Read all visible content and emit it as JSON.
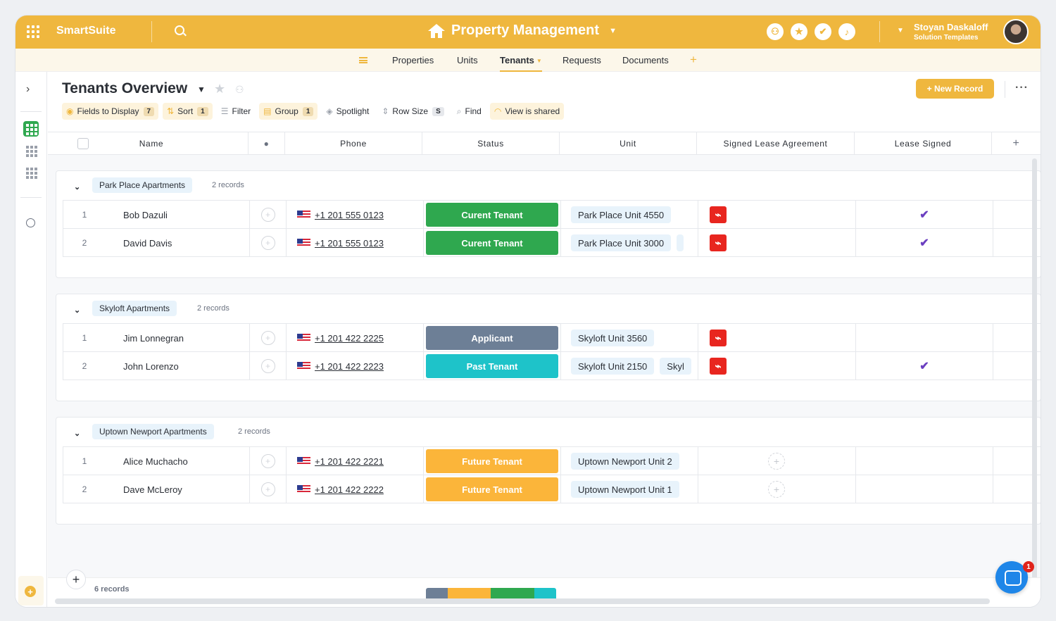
{
  "brand": "SmartSuite",
  "app_title": "Property Management",
  "user": {
    "name": "Stoyan Daskaloff",
    "subtitle": "Solution Templates"
  },
  "tabs": [
    {
      "label": "Properties"
    },
    {
      "label": "Units"
    },
    {
      "label": "Tenants"
    },
    {
      "label": "Requests"
    },
    {
      "label": "Documents"
    }
  ],
  "view": {
    "title": "Tenants Overview",
    "new_record_label": "+ New Record"
  },
  "toolbar": {
    "fields_label": "Fields to Display",
    "fields_count": "7",
    "sort_label": "Sort",
    "sort_count": "1",
    "filter_label": "Filter",
    "group_label": "Group",
    "group_count": "1",
    "spotlight_label": "Spotlight",
    "rowsize_label": "Row Size",
    "rowsize_value": "S",
    "find_label": "Find",
    "shared_label": "View is shared"
  },
  "columns": {
    "name": "Name",
    "phone": "Phone",
    "status": "Status",
    "unit": "Unit",
    "lease": "Signed Lease Agreement",
    "signed": "Lease Signed"
  },
  "status_colors": {
    "Curent Tenant": "#2fa84f",
    "Applicant": "#6d7f96",
    "Past Tenant": "#1ec3c9",
    "Future Tenant": "#fbb53a"
  },
  "groups": [
    {
      "label": "Park Place Apartments",
      "count": "2 records",
      "rows": [
        {
          "idx": "1",
          "name": "Bob Dazuli",
          "phone": "+1 201 555 0123",
          "status": "Curent Tenant",
          "units": [
            "Park Place Unit 4550"
          ],
          "pdf": true,
          "signed": true
        },
        {
          "idx": "2",
          "name": "David Davis",
          "phone": "+1 201 555 0123",
          "status": "Curent Tenant",
          "units": [
            "Park Place Unit 3000",
            ""
          ],
          "pdf": true,
          "signed": true
        }
      ]
    },
    {
      "label": "Skyloft Apartments",
      "count": "2 records",
      "rows": [
        {
          "idx": "1",
          "name": "Jim Lonnegran",
          "phone": "+1 201 422 2225",
          "status": "Applicant",
          "units": [
            "Skyloft Unit 3560"
          ],
          "pdf": true,
          "signed": false
        },
        {
          "idx": "2",
          "name": "John Lorenzo",
          "phone": "+1 201 422 2223",
          "status": "Past Tenant",
          "units": [
            "Skyloft Unit 2150",
            "Skyl"
          ],
          "pdf": true,
          "signed": true
        }
      ]
    },
    {
      "label": "Uptown Newport Apartments",
      "count": "2 records",
      "rows": [
        {
          "idx": "1",
          "name": "Alice Muchacho",
          "phone": "+1 201 422 2221",
          "status": "Future Tenant",
          "units": [
            "Uptown Newport Unit 2"
          ],
          "pdf": false,
          "signed": false
        },
        {
          "idx": "2",
          "name": "Dave McLeroy",
          "phone": "+1 201 422 2222",
          "status": "Future Tenant",
          "units": [
            "Uptown Newport Unit 1"
          ],
          "pdf": false,
          "signed": false
        }
      ]
    }
  ],
  "footer": {
    "record_count": "6 records"
  },
  "chat_badge": "1",
  "summary_bar": [
    {
      "color": "#6d7f96",
      "fraction": 0.167
    },
    {
      "color": "#fbb53a",
      "fraction": 0.333
    },
    {
      "color": "#2fa84f",
      "fraction": 0.333
    },
    {
      "color": "#1ec3c9",
      "fraction": 0.167
    }
  ]
}
